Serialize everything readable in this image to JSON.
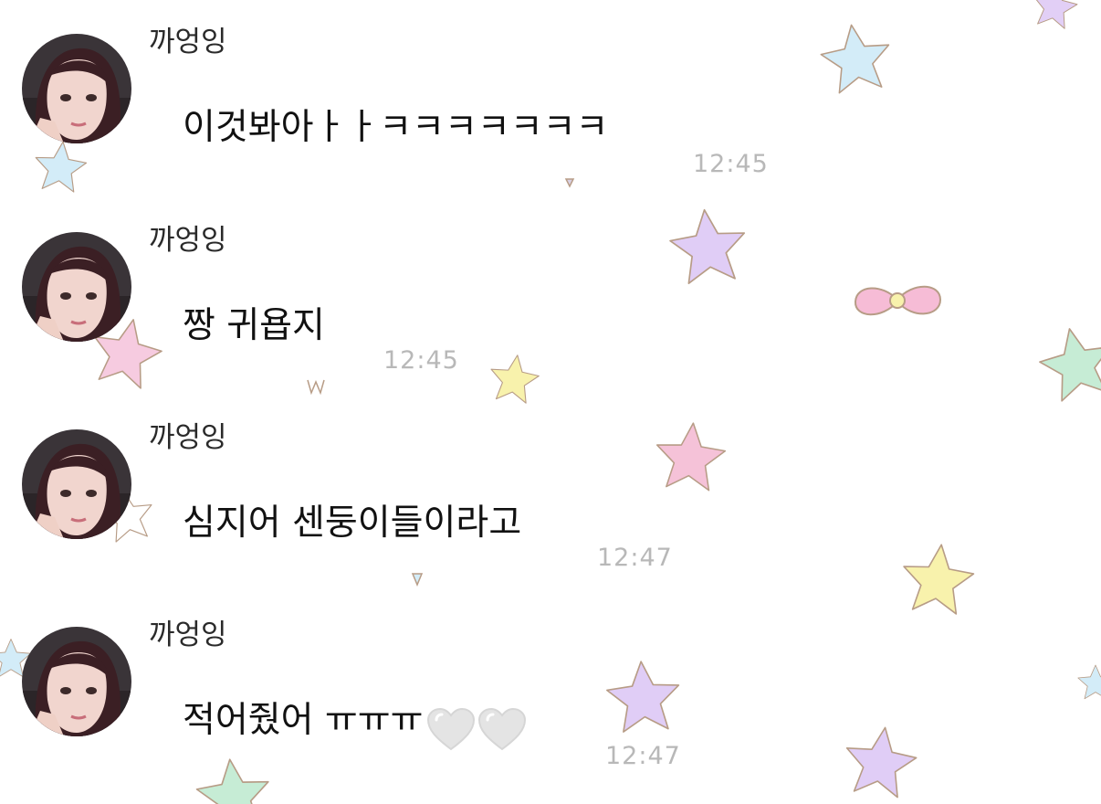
{
  "chat": {
    "messages": [
      {
        "sender": "까엉잉",
        "text": "이것봐아ㅏㅏㅋㅋㅋㅋㅋㅋㅋ",
        "time": "12:45"
      },
      {
        "sender": "까엉잉",
        "text": "짱 귀욥지",
        "time": "12:45"
      },
      {
        "sender": "까엉잉",
        "text": "심지어 센둥이들이라고",
        "time": "12:47"
      },
      {
        "sender": "까엉잉",
        "text": "적어줬어 ㅠㅠㅠ",
        "emoji": [
          "white-heart-icon",
          "white-heart-icon"
        ],
        "time": "12:47"
      }
    ]
  },
  "background": {
    "pattern": "pastel-stars-and-ribbon",
    "colors": [
      "#cfe8f7",
      "#ddc9f5",
      "#f7c7dc",
      "#f7f0a6",
      "#c7ecd6",
      "#f3bdd6"
    ]
  }
}
